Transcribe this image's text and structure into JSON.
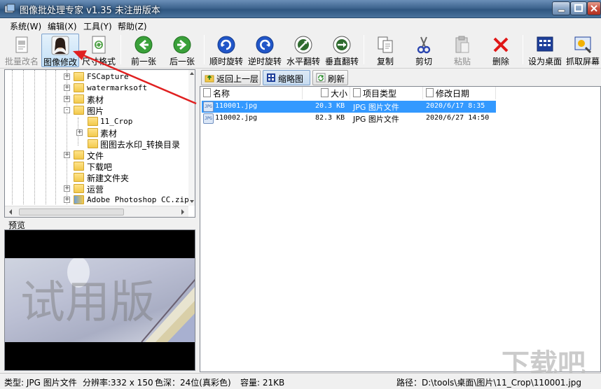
{
  "window": {
    "title": "图像批处理专家 v1.35 未注册版本"
  },
  "menu": [
    "系统(W)",
    "编辑(X)",
    "工具(Y)",
    "帮助(Z)"
  ],
  "toolbar": {
    "batch_rename": "批量改名",
    "image_edit": "图像修改",
    "resize": "尺寸格式",
    "prev": "前一张",
    "next": "后一张",
    "rotate_cw": "顺时旋转",
    "rotate_ccw": "逆时旋转",
    "flip_h": "水平翻转",
    "flip_v": "垂直翻转",
    "copy": "复制",
    "cut": "剪切",
    "paste": "粘贴",
    "delete": "删除",
    "set_wallpaper": "设为桌面",
    "capture": "抓取屏幕"
  },
  "tree": [
    {
      "label": "FSCapture",
      "level": 0,
      "expander": "+"
    },
    {
      "label": "watermarksoft",
      "level": 0,
      "expander": "+"
    },
    {
      "label": "素材",
      "level": 0,
      "expander": "+"
    },
    {
      "label": "图片",
      "level": 0,
      "expander": "-"
    },
    {
      "label": "11_Crop",
      "level": 1,
      "expander": ""
    },
    {
      "label": "素材",
      "level": 1,
      "expander": "+"
    },
    {
      "label": "图图去水印_转换目录",
      "level": 1,
      "expander": ""
    },
    {
      "label": "文件",
      "level": 0,
      "expander": "+"
    },
    {
      "label": "下载吧",
      "level": 0,
      "expander": ""
    },
    {
      "label": "新建文件夹",
      "level": 0,
      "expander": ""
    },
    {
      "label": "运营",
      "level": 0,
      "expander": "+"
    },
    {
      "label": "Adobe Photoshop CC.zip",
      "level": 0,
      "expander": "+"
    }
  ],
  "preview": {
    "label": "预览",
    "watermark": "试用版"
  },
  "nav": {
    "up": "返回上一层",
    "thumbs": "缩略图",
    "refresh": "刷新"
  },
  "columns": {
    "name": "名称",
    "size": "大小",
    "type": "项目类型",
    "date": "修改日期"
  },
  "files": [
    {
      "name": "110001.jpg",
      "size": "20.3 KB",
      "type": "JPG 图片文件",
      "date": "2020/6/17 8:35",
      "selected": true
    },
    {
      "name": "110002.jpg",
      "size": "82.3 KB",
      "type": "JPG 图片文件",
      "date": "2020/6/27 14:50",
      "selected": false
    }
  ],
  "status": {
    "type": "类型: JPG 图片文件",
    "resolution": "分辨率:332 x 150",
    "depth": "色深：24位(真彩色)",
    "size": "容量: 21KB",
    "path": "路径：D:\\tools\\桌面\\图片\\11_Crop\\110001.jpg"
  },
  "site_watermark": "下载吧",
  "colors": {
    "selection": "#3399ff",
    "arrow": "#e02020"
  }
}
